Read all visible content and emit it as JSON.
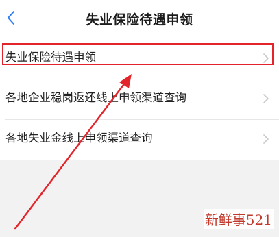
{
  "header": {
    "title": "失业保险待遇申领"
  },
  "list": {
    "items": [
      {
        "label": "失业保险待遇申领"
      },
      {
        "label": "各地企业稳岗返还线上申领渠道查询"
      },
      {
        "label": "各地失业金线上申领渠道查询"
      }
    ]
  },
  "watermark": "新鲜事521",
  "colors": {
    "accent_blue": "#2e7cf6",
    "annotation_red": "#e3252b",
    "watermark_red": "#c0392b"
  },
  "icons": {
    "back": "chevron-left-icon",
    "row": "chevron-right-icon"
  }
}
